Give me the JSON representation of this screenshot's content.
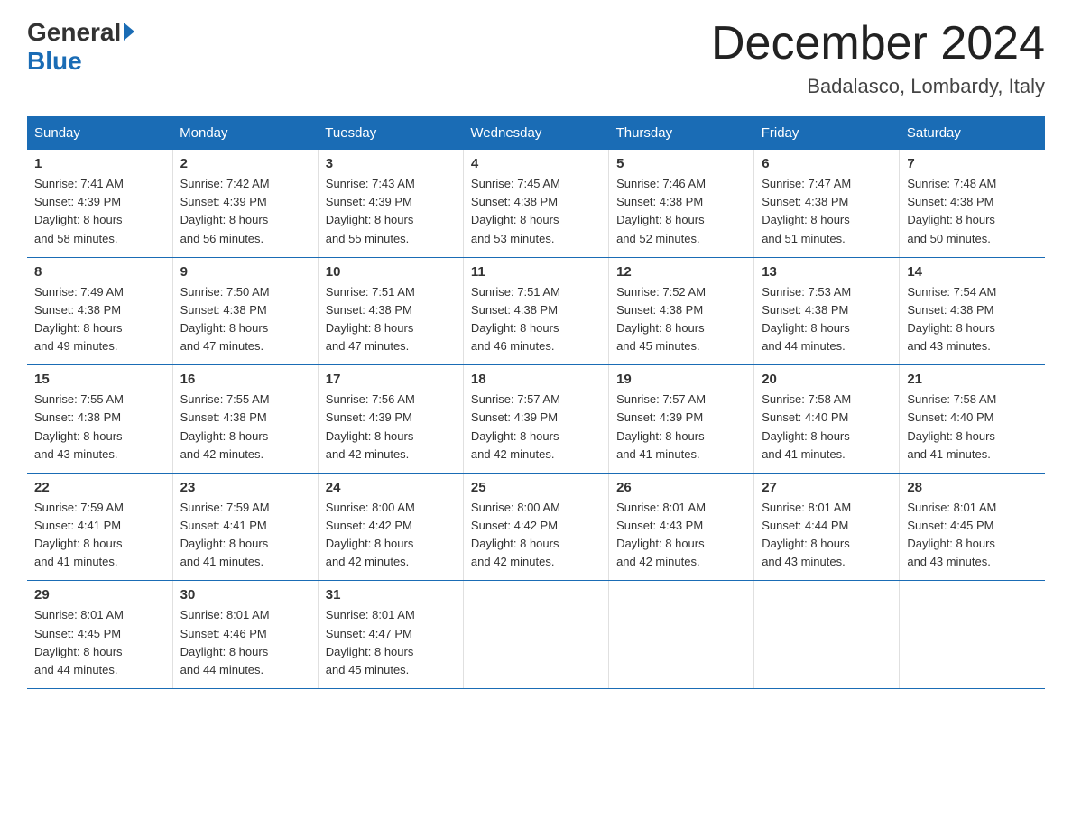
{
  "header": {
    "logo_general": "General",
    "logo_blue": "Blue",
    "month": "December 2024",
    "location": "Badalasco, Lombardy, Italy"
  },
  "days_of_week": [
    "Sunday",
    "Monday",
    "Tuesday",
    "Wednesday",
    "Thursday",
    "Friday",
    "Saturday"
  ],
  "weeks": [
    [
      {
        "day": "1",
        "sunrise": "7:41 AM",
        "sunset": "4:39 PM",
        "daylight": "8 hours and 58 minutes."
      },
      {
        "day": "2",
        "sunrise": "7:42 AM",
        "sunset": "4:39 PM",
        "daylight": "8 hours and 56 minutes."
      },
      {
        "day": "3",
        "sunrise": "7:43 AM",
        "sunset": "4:39 PM",
        "daylight": "8 hours and 55 minutes."
      },
      {
        "day": "4",
        "sunrise": "7:45 AM",
        "sunset": "4:38 PM",
        "daylight": "8 hours and 53 minutes."
      },
      {
        "day": "5",
        "sunrise": "7:46 AM",
        "sunset": "4:38 PM",
        "daylight": "8 hours and 52 minutes."
      },
      {
        "day": "6",
        "sunrise": "7:47 AM",
        "sunset": "4:38 PM",
        "daylight": "8 hours and 51 minutes."
      },
      {
        "day": "7",
        "sunrise": "7:48 AM",
        "sunset": "4:38 PM",
        "daylight": "8 hours and 50 minutes."
      }
    ],
    [
      {
        "day": "8",
        "sunrise": "7:49 AM",
        "sunset": "4:38 PM",
        "daylight": "8 hours and 49 minutes."
      },
      {
        "day": "9",
        "sunrise": "7:50 AM",
        "sunset": "4:38 PM",
        "daylight": "8 hours and 47 minutes."
      },
      {
        "day": "10",
        "sunrise": "7:51 AM",
        "sunset": "4:38 PM",
        "daylight": "8 hours and 47 minutes."
      },
      {
        "day": "11",
        "sunrise": "7:51 AM",
        "sunset": "4:38 PM",
        "daylight": "8 hours and 46 minutes."
      },
      {
        "day": "12",
        "sunrise": "7:52 AM",
        "sunset": "4:38 PM",
        "daylight": "8 hours and 45 minutes."
      },
      {
        "day": "13",
        "sunrise": "7:53 AM",
        "sunset": "4:38 PM",
        "daylight": "8 hours and 44 minutes."
      },
      {
        "day": "14",
        "sunrise": "7:54 AM",
        "sunset": "4:38 PM",
        "daylight": "8 hours and 43 minutes."
      }
    ],
    [
      {
        "day": "15",
        "sunrise": "7:55 AM",
        "sunset": "4:38 PM",
        "daylight": "8 hours and 43 minutes."
      },
      {
        "day": "16",
        "sunrise": "7:55 AM",
        "sunset": "4:38 PM",
        "daylight": "8 hours and 42 minutes."
      },
      {
        "day": "17",
        "sunrise": "7:56 AM",
        "sunset": "4:39 PM",
        "daylight": "8 hours and 42 minutes."
      },
      {
        "day": "18",
        "sunrise": "7:57 AM",
        "sunset": "4:39 PM",
        "daylight": "8 hours and 42 minutes."
      },
      {
        "day": "19",
        "sunrise": "7:57 AM",
        "sunset": "4:39 PM",
        "daylight": "8 hours and 41 minutes."
      },
      {
        "day": "20",
        "sunrise": "7:58 AM",
        "sunset": "4:40 PM",
        "daylight": "8 hours and 41 minutes."
      },
      {
        "day": "21",
        "sunrise": "7:58 AM",
        "sunset": "4:40 PM",
        "daylight": "8 hours and 41 minutes."
      }
    ],
    [
      {
        "day": "22",
        "sunrise": "7:59 AM",
        "sunset": "4:41 PM",
        "daylight": "8 hours and 41 minutes."
      },
      {
        "day": "23",
        "sunrise": "7:59 AM",
        "sunset": "4:41 PM",
        "daylight": "8 hours and 41 minutes."
      },
      {
        "day": "24",
        "sunrise": "8:00 AM",
        "sunset": "4:42 PM",
        "daylight": "8 hours and 42 minutes."
      },
      {
        "day": "25",
        "sunrise": "8:00 AM",
        "sunset": "4:42 PM",
        "daylight": "8 hours and 42 minutes."
      },
      {
        "day": "26",
        "sunrise": "8:01 AM",
        "sunset": "4:43 PM",
        "daylight": "8 hours and 42 minutes."
      },
      {
        "day": "27",
        "sunrise": "8:01 AM",
        "sunset": "4:44 PM",
        "daylight": "8 hours and 43 minutes."
      },
      {
        "day": "28",
        "sunrise": "8:01 AM",
        "sunset": "4:45 PM",
        "daylight": "8 hours and 43 minutes."
      }
    ],
    [
      {
        "day": "29",
        "sunrise": "8:01 AM",
        "sunset": "4:45 PM",
        "daylight": "8 hours and 44 minutes."
      },
      {
        "day": "30",
        "sunrise": "8:01 AM",
        "sunset": "4:46 PM",
        "daylight": "8 hours and 44 minutes."
      },
      {
        "day": "31",
        "sunrise": "8:01 AM",
        "sunset": "4:47 PM",
        "daylight": "8 hours and 45 minutes."
      },
      null,
      null,
      null,
      null
    ]
  ],
  "labels": {
    "sunrise": "Sunrise:",
    "sunset": "Sunset:",
    "daylight": "Daylight:"
  },
  "colors": {
    "header_bg": "#1a6cb5",
    "border": "#1a6cb5"
  }
}
